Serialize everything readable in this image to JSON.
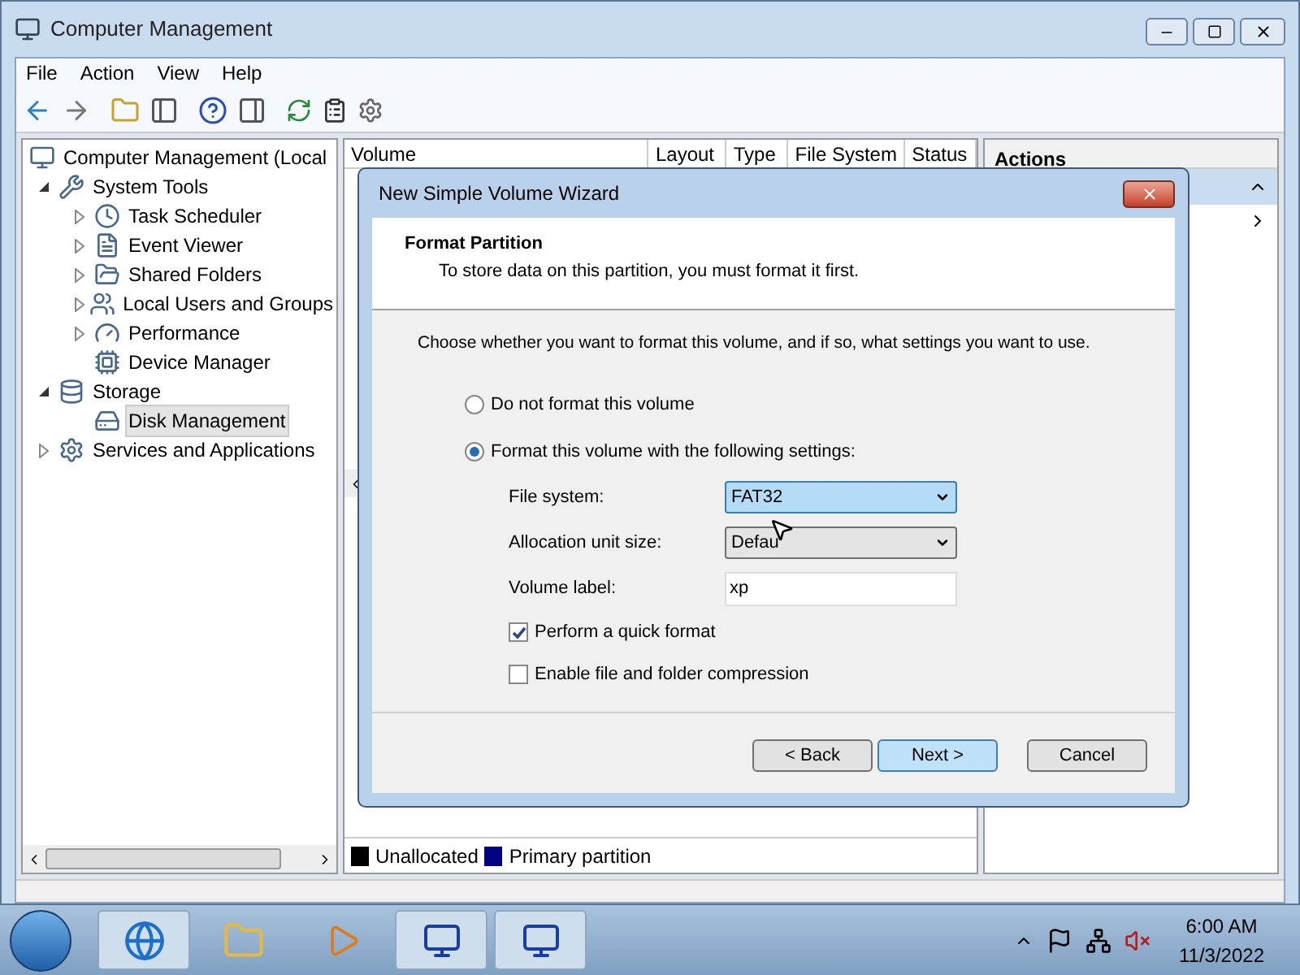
{
  "window": {
    "title": "Computer Management"
  },
  "menu": [
    {
      "label": "File"
    },
    {
      "label": "Action"
    },
    {
      "label": "View"
    },
    {
      "label": "Help"
    }
  ],
  "tree": [
    {
      "label": "Computer Management (Local",
      "selected": false,
      "children": [
        {
          "label": "System Tools",
          "expanded": true,
          "selected": false,
          "children": [
            {
              "label": "Task Scheduler",
              "expanded": false,
              "selected": false
            },
            {
              "label": "Event Viewer",
              "expanded": false,
              "selected": false
            },
            {
              "label": "Shared Folders",
              "expanded": false,
              "selected": false
            },
            {
              "label": "Local Users and Groups",
              "expanded": false,
              "selected": false
            },
            {
              "label": "Performance",
              "expanded": false,
              "selected": false
            },
            {
              "label": "Device Manager",
              "selected": false
            }
          ]
        },
        {
          "label": "Storage",
          "expanded": true,
          "selected": false,
          "children": [
            {
              "label": "Disk Management",
              "selected": true
            }
          ]
        },
        {
          "label": "Services and Applications",
          "expanded": false,
          "selected": false
        }
      ]
    }
  ],
  "volume_table": {
    "columns": [
      "Volume",
      "Layout",
      "Type",
      "File System",
      "Status"
    ]
  },
  "legend": [
    {
      "label": "Unallocated",
      "color": "#000000"
    },
    {
      "label": "Primary partition",
      "color": "#000080"
    }
  ],
  "actions": {
    "header": "Actions"
  },
  "dialog": {
    "title": "New Simple Volume Wizard",
    "heading": "Format Partition",
    "subheading": "To store data on this partition, you must format it first.",
    "instruction": "Choose whether you want to format this volume, and if so, what settings you want to use.",
    "options": [
      {
        "label": "Do not format this volume",
        "selected": false
      },
      {
        "label": "Format this volume with the following settings:",
        "selected": true
      }
    ],
    "fields": [
      {
        "label": "File system:",
        "kind": "dropdown",
        "value": "FAT32",
        "focused": true
      },
      {
        "label": "Allocation unit size:",
        "kind": "dropdown",
        "value": "Defau",
        "focused": false
      },
      {
        "label": "Volume label:",
        "kind": "text",
        "value": "xp"
      }
    ],
    "checkboxes": [
      {
        "label": "Perform a quick format",
        "checked": true
      },
      {
        "label": "Enable file and folder compression",
        "checked": false
      }
    ],
    "buttons": [
      {
        "label": "< Back",
        "default": false
      },
      {
        "label": "Next >",
        "default": true
      },
      {
        "label": "Cancel",
        "default": false
      }
    ]
  },
  "taskbar": {
    "time": "6:00 AM",
    "date": "11/3/2022"
  }
}
